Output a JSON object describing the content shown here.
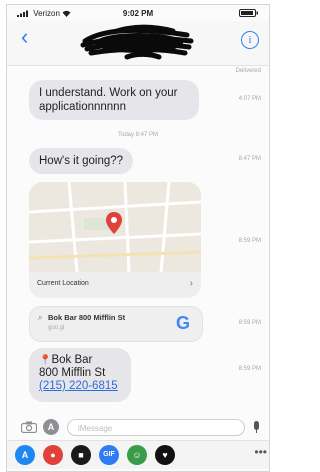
{
  "status": {
    "carrier": "Verizon",
    "time": "9:02 PM"
  },
  "header": {
    "back_glyph": "‹",
    "info_glyph": "i"
  },
  "conversation": {
    "delivered": "Delivered",
    "messages": [
      {
        "text": "I understand. Work on your applicationnnnnn",
        "time": "4:07 PM"
      },
      {
        "day_separator": "Today 8:47 PM"
      },
      {
        "text": "How's it going??",
        "time": "8:47 PM"
      }
    ],
    "map": {
      "label": "Current Location",
      "time": "8:59 PM"
    },
    "google_card": {
      "title": "Bok Bar 800 Mifflin St",
      "subtitle": "goo.gl",
      "logo": "G",
      "time": "8:59 PM"
    },
    "address": {
      "name": "Bok Bar",
      "street": "800 Mifflin St",
      "phone": "(215) 220-6815",
      "time": "8:59 PM"
    }
  },
  "input": {
    "placeholder": "iMessage"
  },
  "app_drawer": {
    "gif_label": "GIF",
    "more_glyph": "•••"
  },
  "colors": {
    "accent": "#2f7bf6",
    "bubble": "#e6e5ea",
    "pin": "#e0413a"
  }
}
